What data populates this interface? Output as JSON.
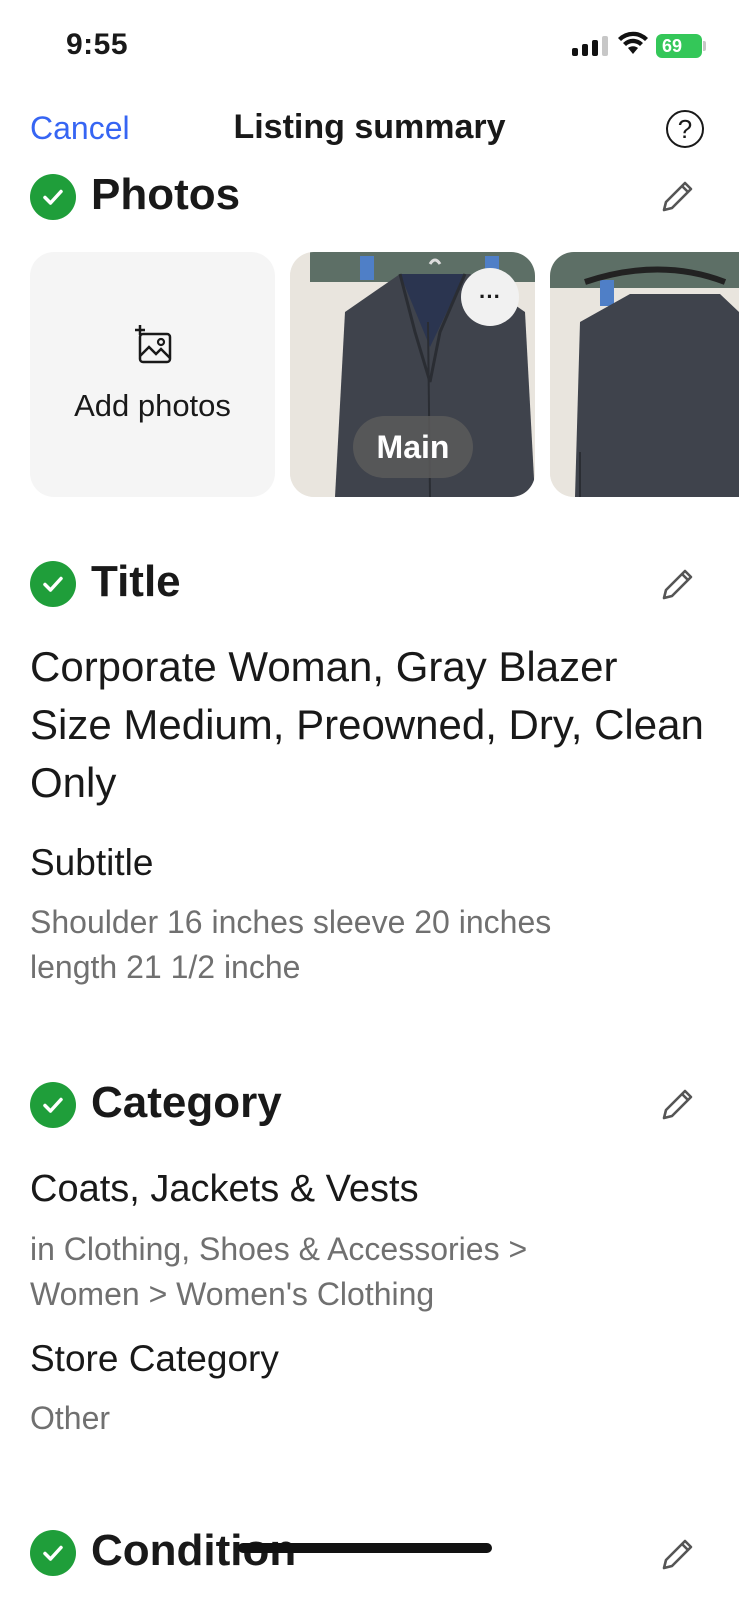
{
  "status_bar": {
    "time": "9:55",
    "battery": "69"
  },
  "nav": {
    "cancel_label": "Cancel",
    "title": "Listing summary",
    "help_label": "?"
  },
  "photos": {
    "section_title": "Photos",
    "add_label": "Add photos",
    "main_badge": "Main",
    "more_label": "···"
  },
  "title_section": {
    "section_title": "Title",
    "title_value": "Corporate Woman, Gray Blazer Size Medium, Preowned, Dry, Clean Only",
    "subtitle_label": "Subtitle",
    "subtitle_value": "Shoulder 16 inches sleeve 20 inches length 21 1/2 inche"
  },
  "category_section": {
    "section_title": "Category",
    "category_name": "Coats, Jackets & Vests",
    "category_path": "in Clothing, Shoes & Accessories > Women > Women's Clothing",
    "store_category_label": "Store Category",
    "store_category_value": "Other"
  },
  "condition_section": {
    "section_title": "Condition"
  },
  "colors": {
    "accent": "#3665f3",
    "check_green": "#1f9e3a",
    "battery_green": "#34c759",
    "muted_text": "#707070"
  },
  "icons": [
    "check-icon",
    "pencil-icon",
    "add-photo-icon",
    "help-icon",
    "wifi-icon",
    "signal-icon",
    "battery-icon"
  ]
}
